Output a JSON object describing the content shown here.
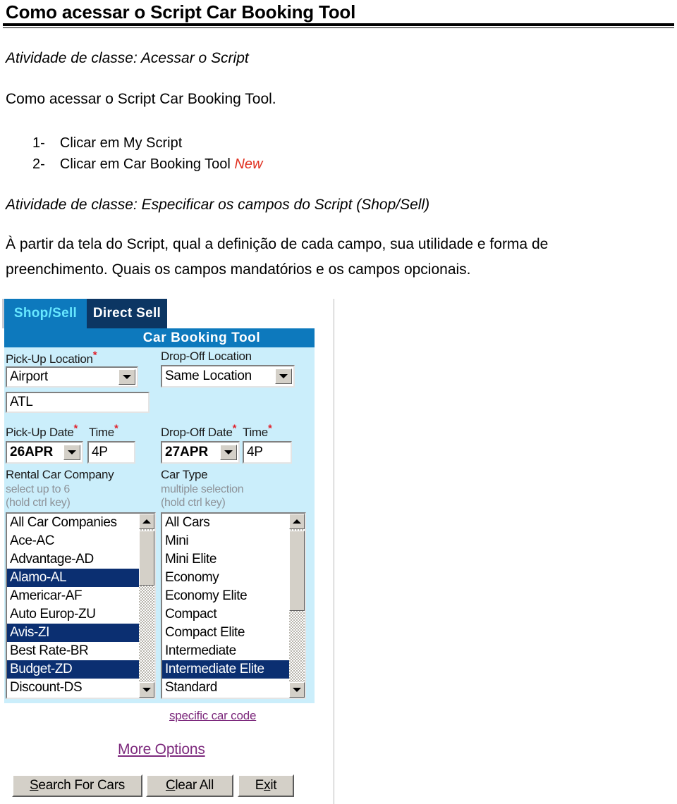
{
  "document": {
    "title": "Como acessar o Script Car Booking Tool",
    "activity_1": "Atividade de classe: Acessar o Script",
    "intro": "Como acessar o Script Car Booking Tool.",
    "steps": [
      {
        "num": "1-",
        "text": "Clicar em My Script",
        "tag": ""
      },
      {
        "num": "2-",
        "text": "Clicar em Car Booking Tool",
        "tag": "New"
      }
    ],
    "activity_2": "Atividade de classe: Especificar os campos do Script (Shop/Sell)",
    "body_line_1": "À partir da tela do Script, qual a definição de cada campo, sua utilidade e forma de",
    "body_line_2": "preenchimento. Quais os campos mandatórios e os campos opcionais."
  },
  "app": {
    "tabs": [
      {
        "label": "Shop/Sell",
        "active": true
      },
      {
        "label": "Direct Sell",
        "active": false
      }
    ],
    "title_bar": "Car Booking Tool",
    "pickup_location": {
      "label": "Pick-Up Location",
      "required": "*",
      "select_value": "Airport",
      "code_value": "ATL"
    },
    "dropoff_location": {
      "label": "Drop-Off Location",
      "required": "",
      "select_value": "Same Location"
    },
    "pickup_date": {
      "label": "Pick-Up Date",
      "required": "*",
      "value": "26APR"
    },
    "pickup_time": {
      "label": "Time",
      "required": "*",
      "value": "4P"
    },
    "dropoff_date": {
      "label": "Drop-Off Date",
      "required": "*",
      "value": "27APR"
    },
    "dropoff_time": {
      "label": "Time",
      "required": "*",
      "value": "4P"
    },
    "rental_company": {
      "label": "Rental Car Company",
      "hint_1": "select up to 6",
      "hint_2": "(hold ctrl key)",
      "options": [
        {
          "label": "All Car Companies",
          "selected": false
        },
        {
          "label": "Ace-AC",
          "selected": false
        },
        {
          "label": "Advantage-AD",
          "selected": false
        },
        {
          "label": "Alamo-AL",
          "selected": true
        },
        {
          "label": "Americar-AF",
          "selected": false
        },
        {
          "label": "Auto Europ-ZU",
          "selected": false
        },
        {
          "label": "Avis-ZI",
          "selected": true
        },
        {
          "label": "Best Rate-BR",
          "selected": false
        },
        {
          "label": "Budget-ZD",
          "selected": true
        },
        {
          "label": "Discount-DS",
          "selected": false
        }
      ]
    },
    "car_type": {
      "label": "Car Type",
      "hint_1": "multiple selection",
      "hint_2": "(hold ctrl key)",
      "options": [
        {
          "label": "All Cars",
          "selected": false
        },
        {
          "label": "Mini",
          "selected": false
        },
        {
          "label": "Mini Elite",
          "selected": false
        },
        {
          "label": "Economy",
          "selected": false
        },
        {
          "label": "Economy Elite",
          "selected": false
        },
        {
          "label": "Compact",
          "selected": false
        },
        {
          "label": "Compact Elite",
          "selected": false
        },
        {
          "label": "Intermediate",
          "selected": false
        },
        {
          "label": "Intermediate Elite",
          "selected": true
        },
        {
          "label": "Standard",
          "selected": false
        }
      ]
    },
    "links": {
      "specific_car_code": "specific car code",
      "more_options": "More Options"
    },
    "buttons": [
      {
        "pre": "",
        "accel": "S",
        "post": "earch For Cars"
      },
      {
        "pre": "",
        "accel": "C",
        "post": "lear All"
      },
      {
        "pre": "E",
        "accel": "x",
        "post": "it"
      }
    ],
    "colors": {
      "tab_active_bg": "#0d79bd",
      "tab_active_fg": "#67e7ff",
      "tab_inactive_bg": "#0c3663",
      "panel_bg": "#cbeefb",
      "selection_bg": "#0b2f71",
      "link_fg": "#7d2a7d",
      "required_star": "#e0202a",
      "new_tag": "#e03020"
    }
  }
}
